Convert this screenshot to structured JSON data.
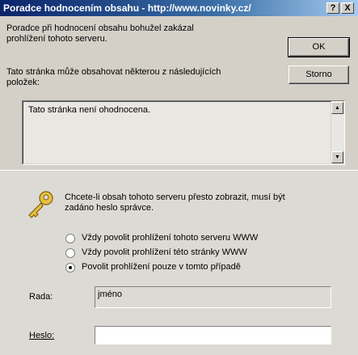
{
  "window": {
    "title": "Poradce hodnocením obsahu - http://www.novinky.cz/",
    "help_label": "?",
    "close_label": "X"
  },
  "message": {
    "line1": "Poradce při hodnocení obsahu bohužel zakázal",
    "line2": "prohlížení tohoto serveru.",
    "line3": "Tato stránka může obsahovat některou z následujících",
    "line4": "položek:"
  },
  "buttons": {
    "ok": "OK",
    "cancel": "Storno"
  },
  "reasons_list": {
    "items": [
      "Tato stránka není ohodnocena."
    ]
  },
  "password_section": {
    "prompt_line1": "Chcete-li obsah tohoto serveru přesto zobrazit, musí být",
    "prompt_line2": "zadáno heslo správce.",
    "options": [
      {
        "label": "Vždy povolit prohlížení tohoto serveru WWW",
        "selected": false
      },
      {
        "label": "Vždy povolit prohlížení této stránky WWW",
        "selected": false
      },
      {
        "label": "Povolit prohlížení pouze v tomto případě",
        "selected": true
      }
    ],
    "hint_label": "Rada:",
    "hint_value": "jméno",
    "password_label": "Heslo:",
    "password_value": ""
  }
}
